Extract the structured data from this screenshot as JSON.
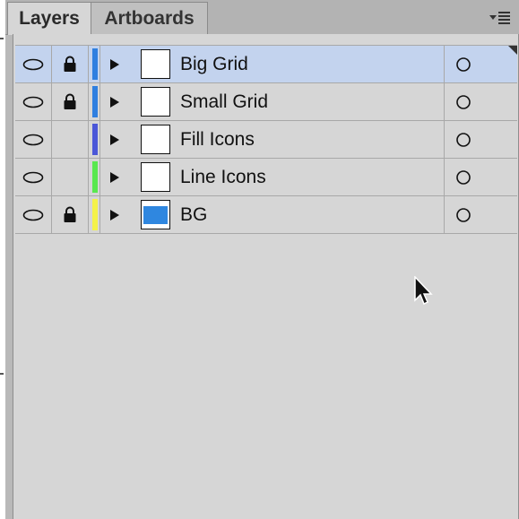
{
  "tabs": [
    {
      "label": "Layers",
      "active": true
    },
    {
      "label": "Artboards",
      "active": false
    }
  ],
  "layers": [
    {
      "name": "Big Grid",
      "visible": true,
      "locked": true,
      "color": "#2f7fe0",
      "selected": true,
      "thumbnail": "blank"
    },
    {
      "name": "Small Grid",
      "visible": true,
      "locked": true,
      "color": "#2f7fe0",
      "selected": false,
      "thumbnail": "blank"
    },
    {
      "name": "Fill Icons",
      "visible": true,
      "locked": false,
      "color": "#4b57d8",
      "selected": false,
      "thumbnail": "blank"
    },
    {
      "name": "Line Icons",
      "visible": true,
      "locked": false,
      "color": "#59e84f",
      "selected": false,
      "thumbnail": "blank"
    },
    {
      "name": "BG",
      "visible": true,
      "locked": true,
      "color": "#f4f24a",
      "selected": false,
      "thumbnail": "blue-fill",
      "thumbnail_color": "#2f87e0"
    }
  ],
  "icons": {
    "visibility": "eye-icon",
    "lock": "lock-icon",
    "expand": "triangle-right-icon",
    "target": "circle-target-icon",
    "panel_menu": "panel-menu-icon",
    "cursor": "arrow-cursor-icon"
  }
}
